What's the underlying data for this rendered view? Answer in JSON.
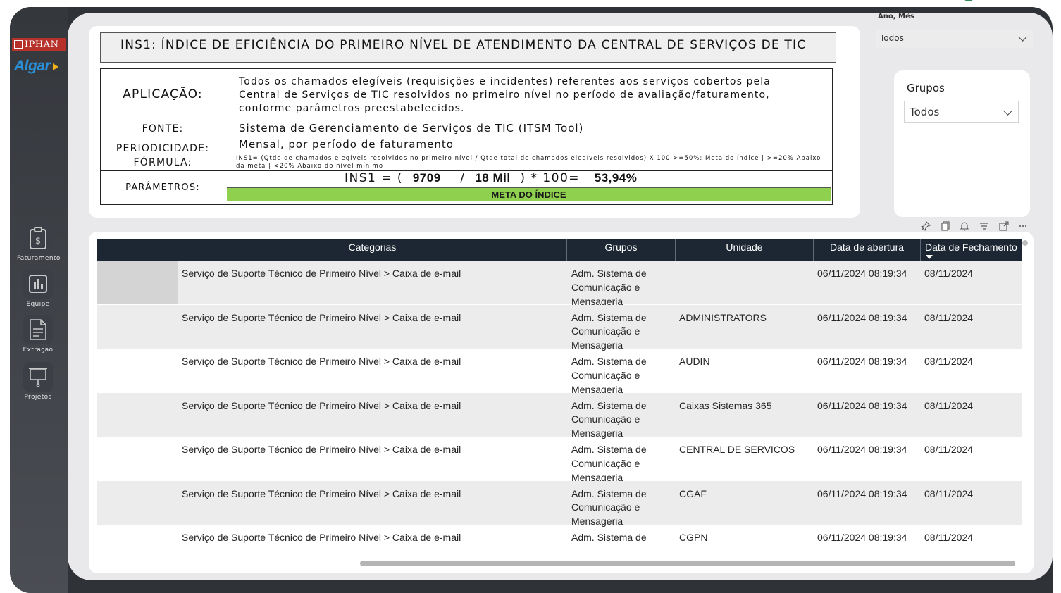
{
  "sidebar": {
    "logo_iphan": "IPHAN",
    "logo_algar": "Algar",
    "nav": [
      {
        "label": "Faturamento",
        "icon": "dollar-clipboard-icon"
      },
      {
        "label": "Equipe",
        "icon": "bar-chart-icon"
      },
      {
        "label": "Extração",
        "icon": "document-icon"
      },
      {
        "label": "Projetos",
        "icon": "presentation-board-icon"
      }
    ]
  },
  "indicator": {
    "title": "INS1: ÍNDICE DE EFICIÊNCIA DO PRIMEIRO NÍVEL DE ATENDIMENTO DA CENTRAL DE SERVIÇOS DE TIC",
    "aplicacao_label": "APLICAÇÃO:",
    "aplicacao_text": "Todos os chamados elegíveis (requisições e incidentes) referentes aos serviços cobertos pela Central de Serviços de TIC resolvidos no primeiro nível no período de avaliação/faturamento, conforme parâmetros preestabelecidos.",
    "fonte_label": "FONTE:",
    "fonte_text": "Sistema de Gerenciamento de Serviços de TIC (ITSM Tool)",
    "periodicidade_label": "PERIODICIDADE:",
    "periodicidade_text": "Mensal, por período de faturamento",
    "formula_label": "FÓRMULA:",
    "formula_text": "INS1= (Qtde de chamados elegíveis resolvidos no primeiro nível / Qtde total de chamados elegíveis resolvidos) X 100 >=50%: Meta do índice | >=20% Abaixo da meta | <20% Abaixo do nível mínimo",
    "parametros_label": "PARÂMETROS:",
    "eq_prefix": "INS1 = (",
    "eq_num": "9709",
    "eq_div": "/",
    "eq_den": "18 Mil",
    "eq_suffix": ") * 100=",
    "eq_result": "53,94%",
    "meta_label": "META DO ÍNDICE",
    "meta_color": "#8fd14f"
  },
  "slicers": {
    "ano_mes_label": "Ano, Mês",
    "ano_mes_value": "Todos",
    "grupos_label": "Grupos",
    "grupos_value": "Todos"
  },
  "table": {
    "columns": [
      "",
      "Categorias",
      "Grupos",
      "Unidade",
      "Data de abertura",
      "Data de Fechamento"
    ],
    "rows": [
      {
        "categoria": "Serviço de Suporte Técnico de Primeiro Nível > Caixa de e-mail",
        "grupo": "Adm. Sistema de Comunicação e Mensageria",
        "unidade": "",
        "abertura": "06/11/2024 08:19:34",
        "fechamento": "08/11/2024"
      },
      {
        "categoria": "Serviço de Suporte Técnico de Primeiro Nível > Caixa de e-mail",
        "grupo": "Adm. Sistema de Comunicação e Mensageria",
        "unidade": "ADMINISTRATORS",
        "abertura": "06/11/2024 08:19:34",
        "fechamento": "08/11/2024"
      },
      {
        "categoria": "Serviço de Suporte Técnico de Primeiro Nível > Caixa de e-mail",
        "grupo": "Adm. Sistema de Comunicação e Mensageria",
        "unidade": "AUDIN",
        "abertura": "06/11/2024 08:19:34",
        "fechamento": "08/11/2024"
      },
      {
        "categoria": "Serviço de Suporte Técnico de Primeiro Nível > Caixa de e-mail",
        "grupo": "Adm. Sistema de Comunicação e Mensageria",
        "unidade": "Caixas Sistemas 365",
        "abertura": "06/11/2024 08:19:34",
        "fechamento": "08/11/2024"
      },
      {
        "categoria": "Serviço de Suporte Técnico de Primeiro Nível > Caixa de e-mail",
        "grupo": "Adm. Sistema de Comunicação e Mensageria",
        "unidade": "CENTRAL DE SERVICOS",
        "abertura": "06/11/2024 08:19:34",
        "fechamento": "08/11/2024"
      },
      {
        "categoria": "Serviço de Suporte Técnico de Primeiro Nível > Caixa de e-mail",
        "grupo": "Adm. Sistema de Comunicação e Mensageria",
        "unidade": "CGAF",
        "abertura": "06/11/2024 08:19:34",
        "fechamento": "08/11/2024"
      },
      {
        "categoria": "Serviço de Suporte Técnico de Primeiro Nível > Caixa de e-mail",
        "grupo": "Adm. Sistema de Comunicação e Mensageria",
        "unidade": "CGPN",
        "abertura": "06/11/2024 08:19:34",
        "fechamento": "08/11/2024"
      }
    ]
  },
  "toolbar_icons": [
    "pin-icon",
    "copy-icon",
    "bell-icon",
    "filter-icon",
    "focus-mode-icon",
    "more-options-icon"
  ]
}
